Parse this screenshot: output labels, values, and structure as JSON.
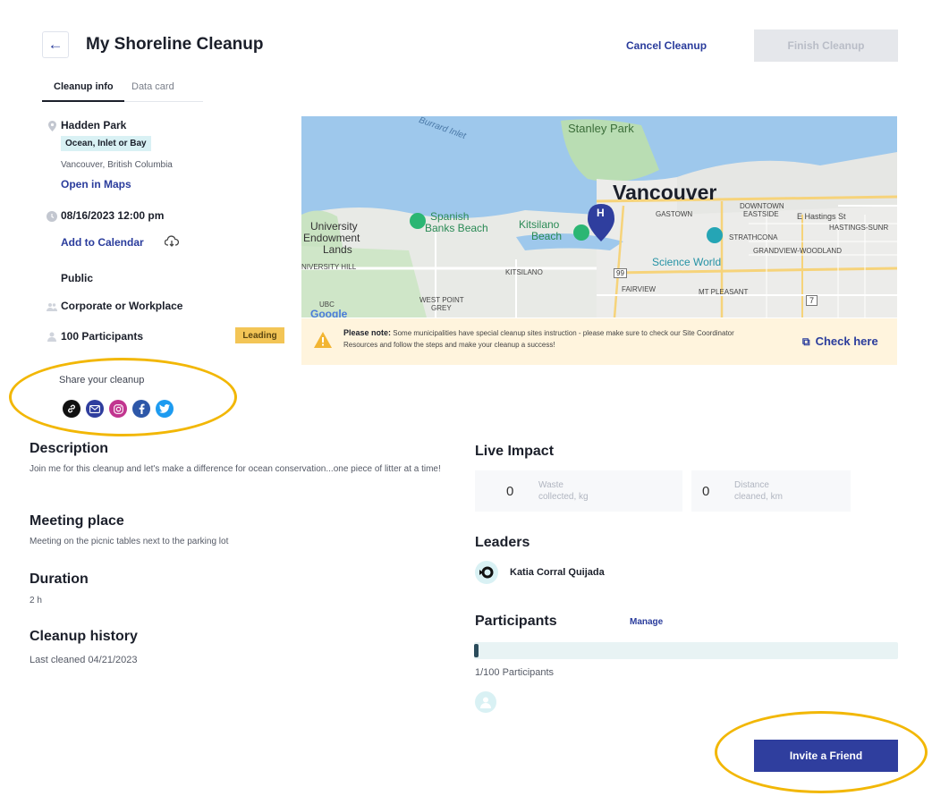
{
  "header": {
    "back_icon": "arrow-left-icon",
    "title": "My Shoreline Cleanup",
    "cancel_label": "Cancel Cleanup",
    "finish_label": "Finish Cleanup"
  },
  "tabs": [
    {
      "label": "Cleanup info",
      "active": true
    },
    {
      "label": "Data card",
      "active": false
    }
  ],
  "info": {
    "location_name": "Hadden Park",
    "location_type": "Ocean, Inlet or Bay",
    "city": "Vancouver, British Columbia",
    "open_maps": "Open in Maps",
    "datetime": "08/16/2023 12:00 pm",
    "add_calendar": "Add to Calendar",
    "visibility": "Public",
    "group_type": "Corporate or Workplace",
    "participants": "100 Participants",
    "leading_badge": "Leading"
  },
  "share": {
    "title": "Share your cleanup",
    "icons": [
      "link-icon",
      "email-icon",
      "instagram-icon",
      "facebook-icon",
      "twitter-icon"
    ]
  },
  "map": {
    "labels": {
      "stanley_park": "Stanley Park",
      "burrard_inlet": "Burrard Inlet",
      "vancouver": "Vancouver",
      "university": "University",
      "endowment": "Endowment",
      "lands": "Lands",
      "spanish": "Spanish",
      "banks_beach": "Banks Beach",
      "kitsilano": "Kitsilano",
      "beach": "Beach",
      "gastown": "GASTOWN",
      "downtown": "DOWNTOWN",
      "eastside": "EASTSIDE",
      "hastings_st": "E Hastings St",
      "hastings_sunr": "HASTINGS-SUNR",
      "strathcona": "STRATHCONA",
      "grandview": "GRANDVIEW-WOODLAND",
      "science_world": "Science World",
      "university_hill": "NIVERSITY HILL",
      "kitsilano_area": "KITSILANO",
      "fairview": "FAIRVIEW",
      "mt_pleasant": "MT PLEASANT",
      "ubc": "UBC",
      "west_point": "WEST POINT",
      "grey": "GREY",
      "hwy_99": "99",
      "hwy_7": "7",
      "marker": "H",
      "google": "Google"
    }
  },
  "notice": {
    "bold": "Please note:",
    "text": " Some municipalities have special cleanup sites instruction - please make sure to check our Site Coordinator Resources and follow the steps and make your cleanup a success!",
    "check_label": "Check here"
  },
  "description": {
    "title": "Description",
    "text": "Join me for this cleanup and let's make a difference for ocean conservation...one piece of litter at a time!"
  },
  "meeting": {
    "title": "Meeting place",
    "text": "Meeting on the picnic tables next to the parking lot"
  },
  "duration": {
    "title": "Duration",
    "text": "2 h"
  },
  "history": {
    "title": "Cleanup history",
    "text": "Last cleaned 04/21/2023"
  },
  "impact": {
    "title": "Live Impact",
    "waste_value": "0",
    "waste_label_1": "Waste",
    "waste_label_2": "collected, kg",
    "distance_value": "0",
    "distance_label_1": "Distance",
    "distance_label_2": "cleaned, km"
  },
  "leaders": {
    "title": "Leaders",
    "name": "Katia Corral Quijada"
  },
  "participants_section": {
    "title": "Participants",
    "manage": "Manage",
    "progress": 0.01,
    "count_text": "1/100 Participants"
  },
  "invite_label": "Invite a Friend",
  "colors": {
    "accent": "#2f3e9e",
    "highlight": "#f2b705",
    "badge": "#f3c556",
    "notice_bg": "#fff4dd"
  }
}
